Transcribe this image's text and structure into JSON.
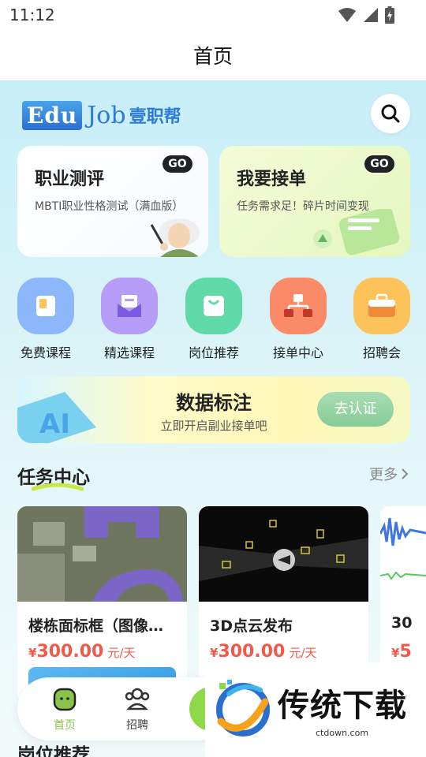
{
  "status_bar": {
    "time": "11:12"
  },
  "header": {
    "title": "首页"
  },
  "logo": {
    "edu": "Edu",
    "job": "Job",
    "cn": "壹职帮"
  },
  "cards": [
    {
      "title": "职业测评",
      "subtitle": "MBTI职业性格测试（满血版）",
      "badge": "GO"
    },
    {
      "title": "我要接单",
      "subtitle": "任务需求足！碎片时间变现",
      "badge": "GO"
    }
  ],
  "grid": [
    {
      "label": "免费课程",
      "icon": "book-icon",
      "color": "#8cb8fb"
    },
    {
      "label": "精选课程",
      "icon": "mail-icon",
      "color": "#b49cf7"
    },
    {
      "label": "岗位推荐",
      "icon": "bag-icon",
      "color": "#5fd9a8"
    },
    {
      "label": "接单中心",
      "icon": "network-icon",
      "color": "#fb8a68"
    },
    {
      "label": "招聘会",
      "icon": "briefcase-icon",
      "color": "#fcc35b"
    }
  ],
  "banner": {
    "title": "数据标注",
    "subtitle": "立即开启副业接单吧",
    "button": "去认证"
  },
  "task_section": {
    "title": "任务中心",
    "more": "更多"
  },
  "tasks": [
    {
      "title": "楼栋面标框（图像…",
      "currency": "¥",
      "price": "300.00",
      "unit": "元/天"
    },
    {
      "title": "3D点云发布",
      "currency": "¥",
      "price": "300.00",
      "unit": "元/天"
    },
    {
      "title": "30",
      "currency": "¥",
      "price": "5",
      "unit": ""
    }
  ],
  "bottom_nav": [
    {
      "label": "首页",
      "active": true
    },
    {
      "label": "招聘",
      "active": false
    }
  ],
  "section2": {
    "title": "岗位推荐"
  },
  "watermark": {
    "text": "传统下载",
    "url": "ctdown.com"
  },
  "colors": {
    "accent_green": "#8dd94a",
    "price_red": "#f15a4a",
    "nav_active": "#8bc34a"
  }
}
